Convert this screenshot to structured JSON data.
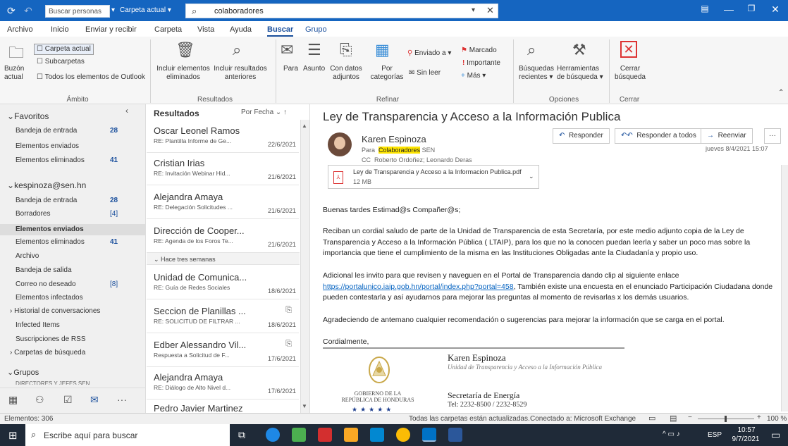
{
  "title_bar": {
    "search_people_placeholder": "Buscar personas",
    "scope_label": "Carpeta actual",
    "search_query": "colaboradores"
  },
  "menu_tabs": [
    "Archivo",
    "Inicio",
    "Enviar y recibir",
    "Carpeta",
    "Vista",
    "Ayuda",
    "Buscar",
    "Grupo"
  ],
  "active_tab": "Buscar",
  "ribbon": {
    "ambito": {
      "buzon_actual": "Buzón actual",
      "carpeta_actual": "Carpeta actual",
      "subcarpetas": "Subcarpetas",
      "todos": "Todos los elementos de Outlook",
      "group": "Ámbito"
    },
    "resultados": {
      "incluir_eliminados": "Incluir elementos eliminados",
      "incluir_anteriores": "Incluir resultados anteriores",
      "group": "Resultados"
    },
    "refinar": {
      "para": "Para",
      "asunto": "Asunto",
      "con_datos": "Con datos adjuntos",
      "por_categorias": "Por categorías",
      "enviado_a": "Enviado a",
      "sin_leer": "Sin leer",
      "marcado": "Marcado",
      "importante": "Importante",
      "mas": "Más",
      "group": "Refinar"
    },
    "opciones": {
      "busquedas": "Búsquedas recientes",
      "herramientas": "Herramientas de búsqueda",
      "group": "Opciones"
    },
    "cerrar": {
      "label": "Cerrar búsqueda",
      "group": "Cerrar"
    }
  },
  "folders": {
    "favoritos": "Favoritos",
    "fav_items": [
      {
        "label": "Bandeja de entrada",
        "count": "28"
      },
      {
        "label": "Elementos enviados",
        "count": ""
      },
      {
        "label": "Elementos eliminados",
        "count": "41"
      }
    ],
    "account": "kespinoza@sen.hn",
    "acct_items": [
      {
        "label": "Bandeja de entrada",
        "count": "28"
      },
      {
        "label": "Borradores",
        "count": "[4]"
      },
      {
        "label": "Elementos enviados",
        "count": ""
      },
      {
        "label": "Elementos eliminados",
        "count": "41"
      },
      {
        "label": "Archivo",
        "count": ""
      },
      {
        "label": "Bandeja de salida",
        "count": ""
      },
      {
        "label": "Correo no deseado",
        "count": "[8]"
      },
      {
        "label": "Elementos infectados",
        "count": ""
      },
      {
        "label": "Historial de conversaciones",
        "count": ""
      },
      {
        "label": "Infected Items",
        "count": ""
      },
      {
        "label": "Suscripciones de RSS",
        "count": ""
      },
      {
        "label": "Carpetas de búsqueda",
        "count": ""
      }
    ],
    "grupos": "Grupos",
    "grupo_item": "DIRECTORES Y JEFES SEN"
  },
  "msglist": {
    "header": "Resultados",
    "sort": "Por Fecha",
    "group_header": "Hace tres semanas",
    "messages": [
      {
        "from": "Oscar Leonel Ramos",
        "subject": "RE: Plantilla Informe de Ge...",
        "date": "22/6/2021"
      },
      {
        "from": "Cristian Irias",
        "subject": "RE: Invitación Webinar Hid...",
        "date": "21/6/2021"
      },
      {
        "from": "Alejandra Amaya",
        "subject": "RE: Delegación Solicitudes ...",
        "date": "21/6/2021"
      },
      {
        "from": "Dirección de Cooper...",
        "subject": "RE: Agenda de los Foros Te...",
        "date": "21/6/2021"
      },
      {
        "from": "Unidad de Comunica...",
        "subject": "RE: Guía de Redes Sociales",
        "date": "18/6/2021"
      },
      {
        "from": "Seccion de Planillas ...",
        "subject": "RE: SOLICITUD DE FILTRAR ...",
        "date": "18/6/2021"
      },
      {
        "from": "Edber Alessandro Vil...",
        "subject": "Respuesta a Solicitud de F...",
        "date": "17/6/2021"
      },
      {
        "from": "Alejandra Amaya",
        "subject": "RE: Diálogo de Alto Nivel d...",
        "date": "17/6/2021"
      },
      {
        "from": "Pedro Javier Martinez",
        "subject": "",
        "date": ""
      }
    ]
  },
  "reading": {
    "subject": "Ley de Transparencia y Acceso a la Información Publica",
    "sender": "Karen Espinoza",
    "to_label": "Para",
    "to_highlight": "Colaboradores",
    "to_rest": "SEN",
    "cc_label": "CC",
    "cc": "Roberto Ordoñez; Leonardo Deras",
    "date": "jueves 8/4/2021 15:07",
    "responder": "Responder",
    "responder_todos": "Responder a todos",
    "reenviar": "Reenviar",
    "attachment_name": "Ley de Transparencia y  Acceso a la Informacion Publica.pdf",
    "attachment_size": "12 MB",
    "greeting": "Buenas tardes Estimad@s Compañer@s;",
    "para1": "Reciban un cordial saludo de parte de la Unidad de Transparencia de esta Secretaría,  por este medio adjunto copia de la Ley de Transparencia y Acceso a la Información Pública ( LTAIP), para los que no la conocen puedan leerla y saber un poco mas sobre la importancia que tiene el cumplimiento de la misma en las Instituciones Obligadas ante la Ciudadanía y propio uso.",
    "para2_a": "Adicional les invito para que revisen y naveguen en el Portal de Transparencia dando clip al siguiente enlace",
    "link": "https://portalunico.iaip.gob.hn/portal/index.php?portal=458",
    "para2_b": ",  También existe una encuesta en el enunciado Participación Ciudadana donde pueden  contestarla y así ayudarnos para mejorar las preguntas al momento de revisarlas x los demás usuarios.",
    "para3": "Agradeciendo de antemano cualquier recomendación o sugerencias para mejorar la información que se carga en el portal.",
    "closing": "Cordialmente,",
    "sig_name": "Karen Espinoza",
    "sig_unit": "Unidad de Transparencia y Acceso a la Información Pública",
    "sig_org": "Secretaría de Energía",
    "sig_tel": "Tel: 2232-8500 / 2232-8529",
    "sig_gov1": "GOBIERNO DE LA",
    "sig_gov2": "REPÚBLICA DE HONDURAS"
  },
  "status": {
    "items": "Elementos: 306",
    "updated": "Todas las carpetas están actualizadas.",
    "connected": "Conectado a: Microsoft Exchange",
    "zoom": "100 %"
  },
  "taskbar": {
    "search_placeholder": "Escribe aquí para buscar",
    "lang": "ESP",
    "time": "10:57",
    "date": "9/7/2021"
  },
  "colors": {
    "accent": "#1565c0",
    "link": "#0563c1",
    "highlight": "#ffe600"
  }
}
